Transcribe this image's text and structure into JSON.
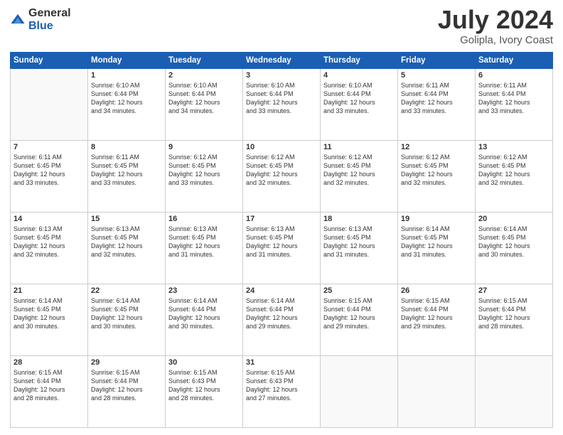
{
  "header": {
    "logo_general": "General",
    "logo_blue": "Blue",
    "title": "July 2024",
    "location": "Golipla, Ivory Coast"
  },
  "weekdays": [
    "Sunday",
    "Monday",
    "Tuesday",
    "Wednesday",
    "Thursday",
    "Friday",
    "Saturday"
  ],
  "weeks": [
    [
      {
        "day": "",
        "text": ""
      },
      {
        "day": "1",
        "text": "Sunrise: 6:10 AM\nSunset: 6:44 PM\nDaylight: 12 hours\nand 34 minutes."
      },
      {
        "day": "2",
        "text": "Sunrise: 6:10 AM\nSunset: 6:44 PM\nDaylight: 12 hours\nand 34 minutes."
      },
      {
        "day": "3",
        "text": "Sunrise: 6:10 AM\nSunset: 6:44 PM\nDaylight: 12 hours\nand 33 minutes."
      },
      {
        "day": "4",
        "text": "Sunrise: 6:10 AM\nSunset: 6:44 PM\nDaylight: 12 hours\nand 33 minutes."
      },
      {
        "day": "5",
        "text": "Sunrise: 6:11 AM\nSunset: 6:44 PM\nDaylight: 12 hours\nand 33 minutes."
      },
      {
        "day": "6",
        "text": "Sunrise: 6:11 AM\nSunset: 6:44 PM\nDaylight: 12 hours\nand 33 minutes."
      }
    ],
    [
      {
        "day": "7",
        "text": "Sunrise: 6:11 AM\nSunset: 6:45 PM\nDaylight: 12 hours\nand 33 minutes."
      },
      {
        "day": "8",
        "text": "Sunrise: 6:11 AM\nSunset: 6:45 PM\nDaylight: 12 hours\nand 33 minutes."
      },
      {
        "day": "9",
        "text": "Sunrise: 6:12 AM\nSunset: 6:45 PM\nDaylight: 12 hours\nand 33 minutes."
      },
      {
        "day": "10",
        "text": "Sunrise: 6:12 AM\nSunset: 6:45 PM\nDaylight: 12 hours\nand 32 minutes."
      },
      {
        "day": "11",
        "text": "Sunrise: 6:12 AM\nSunset: 6:45 PM\nDaylight: 12 hours\nand 32 minutes."
      },
      {
        "day": "12",
        "text": "Sunrise: 6:12 AM\nSunset: 6:45 PM\nDaylight: 12 hours\nand 32 minutes."
      },
      {
        "day": "13",
        "text": "Sunrise: 6:12 AM\nSunset: 6:45 PM\nDaylight: 12 hours\nand 32 minutes."
      }
    ],
    [
      {
        "day": "14",
        "text": "Sunrise: 6:13 AM\nSunset: 6:45 PM\nDaylight: 12 hours\nand 32 minutes."
      },
      {
        "day": "15",
        "text": "Sunrise: 6:13 AM\nSunset: 6:45 PM\nDaylight: 12 hours\nand 32 minutes."
      },
      {
        "day": "16",
        "text": "Sunrise: 6:13 AM\nSunset: 6:45 PM\nDaylight: 12 hours\nand 31 minutes."
      },
      {
        "day": "17",
        "text": "Sunrise: 6:13 AM\nSunset: 6:45 PM\nDaylight: 12 hours\nand 31 minutes."
      },
      {
        "day": "18",
        "text": "Sunrise: 6:13 AM\nSunset: 6:45 PM\nDaylight: 12 hours\nand 31 minutes."
      },
      {
        "day": "19",
        "text": "Sunrise: 6:14 AM\nSunset: 6:45 PM\nDaylight: 12 hours\nand 31 minutes."
      },
      {
        "day": "20",
        "text": "Sunrise: 6:14 AM\nSunset: 6:45 PM\nDaylight: 12 hours\nand 30 minutes."
      }
    ],
    [
      {
        "day": "21",
        "text": "Sunrise: 6:14 AM\nSunset: 6:45 PM\nDaylight: 12 hours\nand 30 minutes."
      },
      {
        "day": "22",
        "text": "Sunrise: 6:14 AM\nSunset: 6:45 PM\nDaylight: 12 hours\nand 30 minutes."
      },
      {
        "day": "23",
        "text": "Sunrise: 6:14 AM\nSunset: 6:44 PM\nDaylight: 12 hours\nand 30 minutes."
      },
      {
        "day": "24",
        "text": "Sunrise: 6:14 AM\nSunset: 6:44 PM\nDaylight: 12 hours\nand 29 minutes."
      },
      {
        "day": "25",
        "text": "Sunrise: 6:15 AM\nSunset: 6:44 PM\nDaylight: 12 hours\nand 29 minutes."
      },
      {
        "day": "26",
        "text": "Sunrise: 6:15 AM\nSunset: 6:44 PM\nDaylight: 12 hours\nand 29 minutes."
      },
      {
        "day": "27",
        "text": "Sunrise: 6:15 AM\nSunset: 6:44 PM\nDaylight: 12 hours\nand 28 minutes."
      }
    ],
    [
      {
        "day": "28",
        "text": "Sunrise: 6:15 AM\nSunset: 6:44 PM\nDaylight: 12 hours\nand 28 minutes."
      },
      {
        "day": "29",
        "text": "Sunrise: 6:15 AM\nSunset: 6:44 PM\nDaylight: 12 hours\nand 28 minutes."
      },
      {
        "day": "30",
        "text": "Sunrise: 6:15 AM\nSunset: 6:43 PM\nDaylight: 12 hours\nand 28 minutes."
      },
      {
        "day": "31",
        "text": "Sunrise: 6:15 AM\nSunset: 6:43 PM\nDaylight: 12 hours\nand 27 minutes."
      },
      {
        "day": "",
        "text": ""
      },
      {
        "day": "",
        "text": ""
      },
      {
        "day": "",
        "text": ""
      }
    ]
  ]
}
